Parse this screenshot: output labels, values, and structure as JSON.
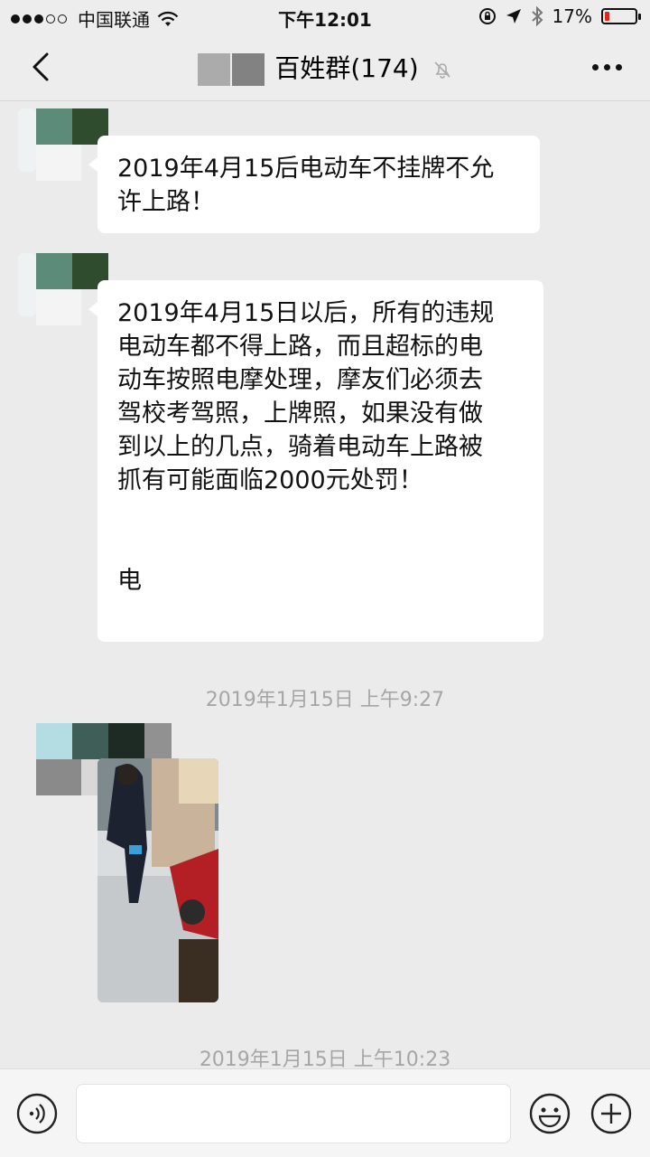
{
  "status_bar": {
    "carrier": "中国联通",
    "time": "下午12:01",
    "battery_percent_label": "17%",
    "battery_level": 0.17,
    "battery_color": "#e0271c"
  },
  "nav": {
    "title": "百姓群(174)",
    "back_icon": "chevron-left-icon",
    "mute_icon": "bell-slash-icon",
    "more_icon": "ellipsis-icon"
  },
  "messages": [
    {
      "type": "text",
      "text_lines": [
        "2019年4月15后电动车不挂牌不允",
        "许上路！"
      ]
    },
    {
      "type": "text",
      "text_lines": [
        "2019年4月15日以后，所有的违规",
        "电动车都不得上路，而且超标的电",
        "动车按照电摩处理，摩友们必须去",
        "驾校考驾照，上牌照，如果没有做",
        "到以上的几点，骑着电动车上路被",
        "抓有可能面临2000元处罚！",
        "",
        "",
        "电"
      ]
    },
    {
      "type": "timestamp",
      "text": "2019年1月15日 上午9:27"
    },
    {
      "type": "image",
      "description_icon": "photo-thumbnail"
    },
    {
      "type": "timestamp",
      "text": "2019年1月15日 上午10:23"
    }
  ],
  "input_bar": {
    "voice_icon": "voice-icon",
    "emoji_icon": "emoji-icon",
    "plus_icon": "plus-circle-icon",
    "placeholder": ""
  }
}
